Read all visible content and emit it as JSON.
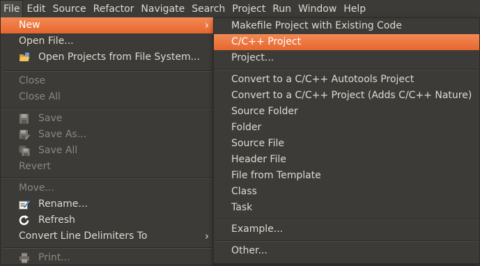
{
  "menubar": {
    "items": [
      "File",
      "Edit",
      "Source",
      "Refactor",
      "Navigate",
      "Search",
      "Project",
      "Run",
      "Window",
      "Help"
    ]
  },
  "file_menu": {
    "new": "New",
    "open_file": "Open File...",
    "open_projects": "Open Projects from File System...",
    "close": "Close",
    "close_all": "Close All",
    "save": "Save",
    "save_as": "Save As...",
    "save_all": "Save All",
    "revert": "Revert",
    "move": "Move...",
    "rename": "Rename...",
    "refresh": "Refresh",
    "convert_line_delimiters": "Convert Line Delimiters To",
    "print": "Print..."
  },
  "new_menu": {
    "makefile_project": "Makefile Project with Existing Code",
    "cpp_project": "C/C++ Project",
    "project": "Project...",
    "convert_autotools": "Convert to a C/C++ Autotools Project",
    "convert_cpp": "Convert to a C/C++ Project (Adds C/C++ Nature)",
    "source_folder": "Source Folder",
    "folder": "Folder",
    "source_file": "Source File",
    "header_file": "Header File",
    "file_from_template": "File from Template",
    "class": "Class",
    "task": "Task",
    "example": "Example...",
    "other": "Other..."
  },
  "icons": {
    "submenu_arrow": "submenu-arrow-icon",
    "open_projects": "folder-open-icon",
    "save": "floppy-disk-icon",
    "save_as": "floppy-disk-pencil-icon",
    "save_all": "floppy-disks-icon",
    "rename": "rename-icon",
    "refresh": "refresh-icon",
    "print": "printer-icon"
  },
  "colors": {
    "menu_background": "#3c3b37",
    "highlight": "#e7662e",
    "text": "#dfdbd2",
    "disabled_text": "#8b877e"
  }
}
